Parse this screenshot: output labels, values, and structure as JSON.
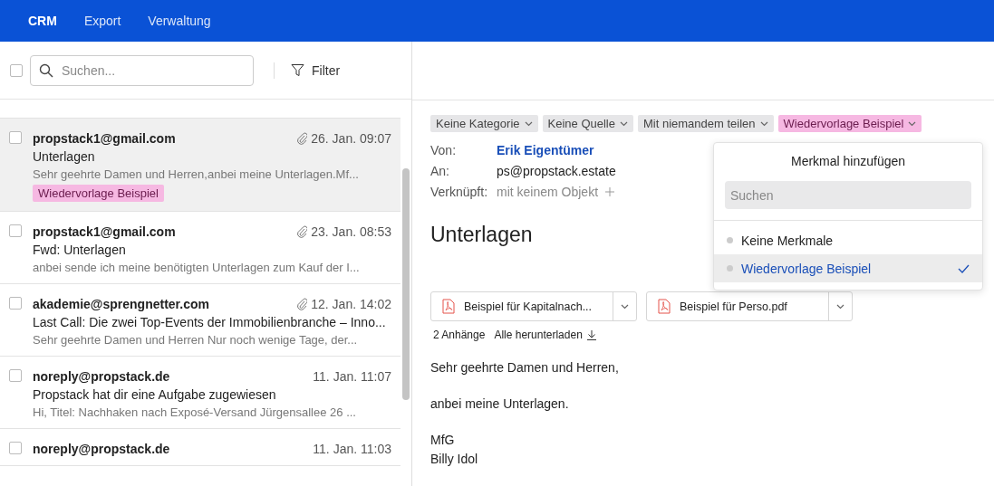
{
  "nav": {
    "items": [
      {
        "label": "CRM",
        "selected": true
      },
      {
        "label": "Export",
        "selected": false
      },
      {
        "label": "Verwaltung",
        "selected": false
      }
    ]
  },
  "toolbar": {
    "select_all_checked": false,
    "search_placeholder": "Suchen...",
    "filter_label": "Filter"
  },
  "messages": [
    {
      "sender": "propstack1@gmail.com",
      "date": "26. Jan. 09:07",
      "attachment": true,
      "subject": "Unterlagen",
      "preview": "Sehr geehrte Damen und Herren,anbei meine Unterlagen.Mf...",
      "tag": "Wiedervorlage Beispiel",
      "selected": true,
      "checked": false
    },
    {
      "sender": "propstack1@gmail.com",
      "date": "23. Jan. 08:53",
      "attachment": true,
      "subject": "Fwd: Unterlagen",
      "preview": "anbei sende ich meine benötigten Unterlagen zum Kauf der I...",
      "selected": false,
      "checked": false
    },
    {
      "sender": "akademie@sprengnetter.com",
      "date": "12. Jan. 14:02",
      "attachment": true,
      "subject": "Last Call: Die zwei Top-Events der Immobilienbranche – Inno...",
      "preview": "Sehr geehrte Damen und Herren Nur noch wenige Tage, der...",
      "selected": false,
      "checked": false
    },
    {
      "sender": "noreply@propstack.de",
      "date": "11. Jan. 11:07",
      "attachment": false,
      "subject": "Propstack hat dir eine Aufgabe zugewiesen",
      "preview": "Hi, Titel: Nachhaken nach Exposé-Versand Jürgensallee 26 ...",
      "selected": false,
      "checked": false
    },
    {
      "sender": "noreply@propstack.de",
      "date": "11. Jan. 11:03",
      "attachment": false,
      "selected": false,
      "checked": false
    }
  ],
  "detail": {
    "chips": [
      {
        "label": "Keine Kategorie",
        "kind": "plain"
      },
      {
        "label": "Keine Quelle",
        "kind": "plain"
      },
      {
        "label": "Mit niemandem teilen",
        "kind": "plain"
      },
      {
        "label": "Wiedervorlage Beispiel",
        "kind": "tag"
      }
    ],
    "fields": [
      {
        "label": "Von:",
        "value": "Erik Eigentümer",
        "kind": "link"
      },
      {
        "label": "An:",
        "value": "ps@propstack.estate",
        "kind": "text"
      },
      {
        "label": "Verknüpft:",
        "value": "mit keinem Objekt",
        "kind": "add"
      }
    ],
    "subject": "Unterlagen",
    "attachments": [
      {
        "name": "Beispiel für Kapitalnach..."
      },
      {
        "name": "Beispiel für Perso.pdf"
      }
    ],
    "attachment_count": "2 Anhänge",
    "download_all": "Alle herunterladen",
    "body": [
      "Sehr geehrte Damen und Herren,",
      "anbei meine Unterlagen.",
      "MfG\nBilly Idol"
    ]
  },
  "popover": {
    "title": "Merkmal hinzufügen",
    "search_placeholder": "Suchen",
    "options": [
      {
        "label": "Keine Merkmale",
        "selected": false
      },
      {
        "label": "Wiedervorlage Beispiel",
        "selected": true
      }
    ]
  }
}
